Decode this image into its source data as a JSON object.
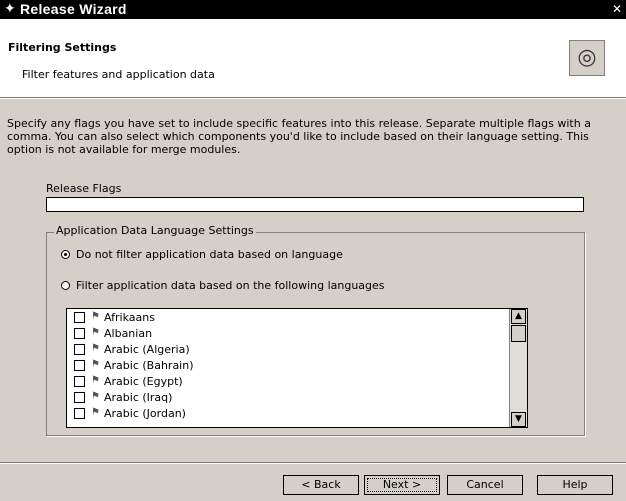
{
  "window": {
    "title": "Release Wizard",
    "close_label": "✕"
  },
  "header": {
    "title": "Filtering Settings",
    "subtitle": "Filter features and application data"
  },
  "description": "Specify any flags you have set to include specific features into this release. Separate multiple flags with a comma. You can also select which components you'd like to include based on their language setting. This option is not available for merge modules.",
  "release_flags": {
    "label": "Release Flags",
    "value": ""
  },
  "language_settings": {
    "group_label": "Application Data Language Settings",
    "radio_no_filter": "Do not filter application data based on language",
    "radio_filter": "Filter application data based on the following languages",
    "selected": "no_filter",
    "languages": [
      "Afrikaans",
      "Albanian",
      "Arabic (Algeria)",
      "Arabic (Bahrain)",
      "Arabic (Egypt)",
      "Arabic (Iraq)",
      "Arabic (Jordan)"
    ]
  },
  "buttons": {
    "back": "< Back",
    "next": "Next >",
    "cancel": "Cancel",
    "help": "Help"
  }
}
